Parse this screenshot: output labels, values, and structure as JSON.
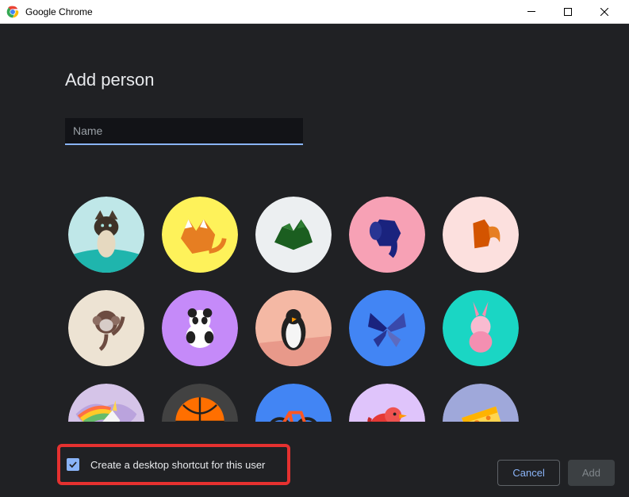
{
  "window": {
    "title": "Google Chrome"
  },
  "dialog": {
    "heading": "Add person",
    "name_placeholder": "Name",
    "name_value": "",
    "avatars": [
      {
        "id": "cat",
        "bg": "#bfe7e8"
      },
      {
        "id": "fox",
        "bg": "#fef25a"
      },
      {
        "id": "dragon",
        "bg": "#eceff1"
      },
      {
        "id": "elephant",
        "bg": "#f7a1b5"
      },
      {
        "id": "squirrel",
        "bg": "#fce0de"
      },
      {
        "id": "monkey",
        "bg": "#ede3d3"
      },
      {
        "id": "panda",
        "bg": "#c58af9"
      },
      {
        "id": "penguin",
        "bg": "#f4b8a4"
      },
      {
        "id": "butterfly",
        "bg": "#4285f4"
      },
      {
        "id": "rabbit",
        "bg": "#1ad6c4"
      },
      {
        "id": "unicorn",
        "bg": "#d5c4e8"
      },
      {
        "id": "basketball",
        "bg": "#424242"
      },
      {
        "id": "bicycle",
        "bg": "#4285f4"
      },
      {
        "id": "bird",
        "bg": "#dfc4fb"
      },
      {
        "id": "cheese",
        "bg": "#9fa8da"
      }
    ],
    "checkbox": {
      "checked": true,
      "label": "Create a desktop shortcut for this user"
    },
    "buttons": {
      "cancel": "Cancel",
      "add": "Add"
    }
  }
}
